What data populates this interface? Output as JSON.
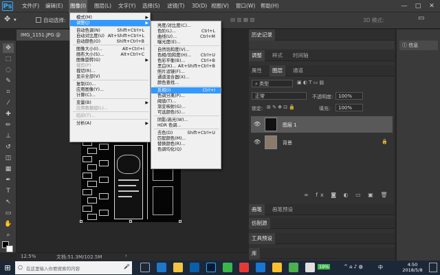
{
  "app": {
    "logo": "Ps"
  },
  "menubar": {
    "items": [
      "文件(F)",
      "编辑(E)",
      "图像(I)",
      "图层(L)",
      "文字(Y)",
      "选择(S)",
      "滤镜(T)",
      "3D(D)",
      "视图(V)",
      "窗口(W)",
      "帮助(H)"
    ],
    "window_controls": [
      "—",
      "□",
      "✕"
    ]
  },
  "options": {
    "auto_select": "自动选择:",
    "right_label": "3D 模式:"
  },
  "document": {
    "tab": "IMG_1151.JPG @",
    "zoom": "12.5%",
    "doc_info": "文档:51.3M/102.5M"
  },
  "image_menu": {
    "items": [
      {
        "label": "模式(M)",
        "shortcut": "",
        "arrow": true
      },
      {
        "label": "调整(J)",
        "shortcut": "",
        "arrow": true,
        "highlight": true
      },
      {
        "sep": true
      },
      {
        "label": "自动色调(N)",
        "shortcut": "Shift+Ctrl+L"
      },
      {
        "label": "自动对比度(U)",
        "shortcut": "Alt+Shift+Ctrl+L"
      },
      {
        "label": "自动颜色(O)",
        "shortcut": "Shift+Ctrl+B"
      },
      {
        "sep": true
      },
      {
        "label": "图像大小(I)...",
        "shortcut": "Alt+Ctrl+I"
      },
      {
        "label": "画布大小(S)...",
        "shortcut": "Alt+Ctrl+C"
      },
      {
        "label": "图像旋转(G)",
        "shortcut": "",
        "arrow": true
      },
      {
        "label": "裁剪(P)",
        "disabled": true
      },
      {
        "label": "裁切(R)..."
      },
      {
        "label": "显示全部(V)"
      },
      {
        "sep": true
      },
      {
        "label": "复制(D)..."
      },
      {
        "label": "应用图像(Y)..."
      },
      {
        "label": "计算(C)..."
      },
      {
        "sep": true
      },
      {
        "label": "变量(B)",
        "arrow": true
      },
      {
        "label": "应用数据组(L)...",
        "disabled": true
      },
      {
        "sep": true
      },
      {
        "label": "陷印(T)...",
        "disabled": true
      },
      {
        "sep": true
      },
      {
        "label": "分析(A)",
        "arrow": true
      }
    ]
  },
  "adjust_menu": {
    "items": [
      {
        "label": "亮度/对比度(C)...",
        "shortcut": ""
      },
      {
        "label": "色阶(L)...",
        "shortcut": "Ctrl+L"
      },
      {
        "label": "曲线(U)...",
        "shortcut": "Ctrl+M"
      },
      {
        "label": "曝光度(E)...",
        "shortcut": ""
      },
      {
        "sep": true
      },
      {
        "label": "自然饱和度(V)...",
        "shortcut": ""
      },
      {
        "label": "色相/饱和度(H)...",
        "shortcut": "Ctrl+U"
      },
      {
        "label": "色彩平衡(B)...",
        "shortcut": "Ctrl+B"
      },
      {
        "label": "黑白(K)...",
        "shortcut": "Alt+Shift+Ctrl+B"
      },
      {
        "label": "照片滤镜(F)...",
        "shortcut": ""
      },
      {
        "label": "通道混合器(X)...",
        "shortcut": ""
      },
      {
        "label": "颜色查找...",
        "shortcut": ""
      },
      {
        "sep": true
      },
      {
        "label": "反相(I)",
        "shortcut": "Ctrl+I",
        "highlight": true
      },
      {
        "label": "色调分离(P)...",
        "shortcut": ""
      },
      {
        "label": "阈值(T)...",
        "shortcut": ""
      },
      {
        "label": "渐变映射(G)...",
        "shortcut": ""
      },
      {
        "label": "可选颜色(S)...",
        "shortcut": ""
      },
      {
        "sep": true
      },
      {
        "label": "阴影/高光(W)...",
        "shortcut": ""
      },
      {
        "label": "HDR 色调...",
        "shortcut": ""
      },
      {
        "sep": true
      },
      {
        "label": "去色(D)",
        "shortcut": "Shift+Ctrl+U"
      },
      {
        "label": "匹配颜色(M)...",
        "shortcut": ""
      },
      {
        "label": "替换颜色(R)...",
        "shortcut": ""
      },
      {
        "label": "色调均化(Q)",
        "shortcut": ""
      }
    ]
  },
  "panels": {
    "history_tab": "历史记录",
    "adjust_tabs": [
      "调整",
      "样式",
      "时间轴"
    ],
    "layer_tabs": [
      "属性",
      "图层",
      "通道"
    ],
    "kind": "类型",
    "blend_mode": "正常",
    "opacity_label": "不透明度:",
    "opacity_value": "100%",
    "lock_label": "锁定:",
    "fill_label": "填充:",
    "fill_value": "100%",
    "layers": [
      {
        "name": "图层 1",
        "selected": true
      },
      {
        "name": "背景",
        "locked": true
      }
    ],
    "bottom_tabs": [
      "画笔",
      "画笔预设"
    ],
    "clone_source": "仿制源",
    "tool_presets": "工具预设",
    "library": "库"
  },
  "rstrip": {
    "info": "信息"
  },
  "taskbar": {
    "search_placeholder": "在这里输入你要搜索的内容",
    "time": "4:50",
    "date": "2018/5/8",
    "battery": "19%",
    "ime": "中"
  },
  "colors": {
    "accent": "#31a8ff",
    "menu_highlight": "#3399ff"
  }
}
